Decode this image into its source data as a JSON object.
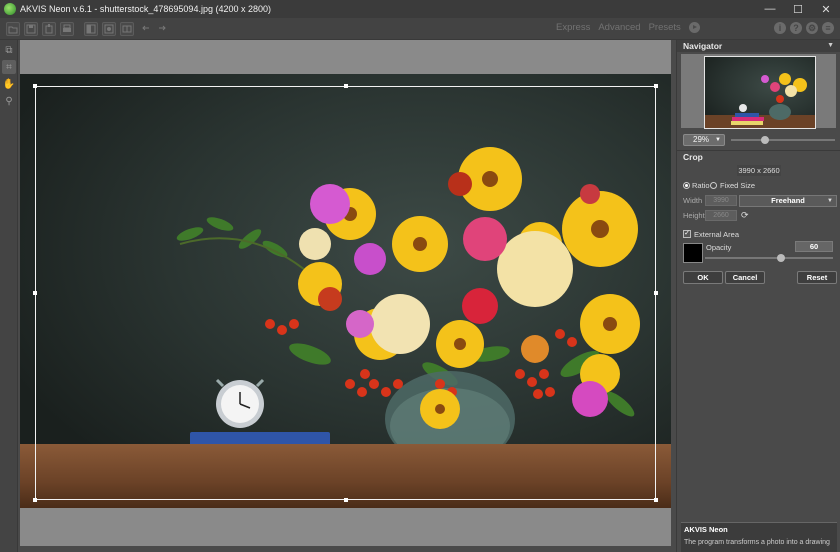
{
  "window": {
    "title": "AKVIS Neon v.6.1 - shutterstock_478695094.jpg (4200 x 2800)",
    "controls": [
      "—",
      "☐",
      "✕"
    ]
  },
  "toolbar": {
    "left_icons": [
      "open-icon",
      "save-icon",
      "share-icon",
      "print-icon",
      "before-icon",
      "after-icon",
      "compare-icon",
      "undo-icon",
      "redo-icon"
    ],
    "modes": [
      "Express",
      "Advanced",
      "Presets"
    ],
    "right_icons": [
      "i",
      "?",
      "⚙",
      "≡"
    ]
  },
  "leftbar": {
    "tools": [
      "crop-tool-icon",
      "crop-active-icon",
      "hand-icon",
      "zoom-icon"
    ]
  },
  "navigator": {
    "title": "Navigator",
    "zoom": "29%",
    "zoom_level": 0.29
  },
  "crop": {
    "title": "Crop",
    "size": "3990 x 2660",
    "ratio_label": "Ratio",
    "fixed_size_label": "Fixed Size",
    "width_label": "Width",
    "height_label": "Height",
    "width_value": "3990",
    "height_value": "2660",
    "mode": "Freehand",
    "external_area_label": "External Area",
    "external_area_color": "#000000",
    "opacity_label": "Opacity",
    "opacity_value": "60",
    "ok_label": "OK",
    "cancel_label": "Cancel",
    "reset_label": "Reset"
  },
  "help": {
    "title": "AKVIS Neon",
    "text": "The program transforms a photo into a drawing"
  }
}
